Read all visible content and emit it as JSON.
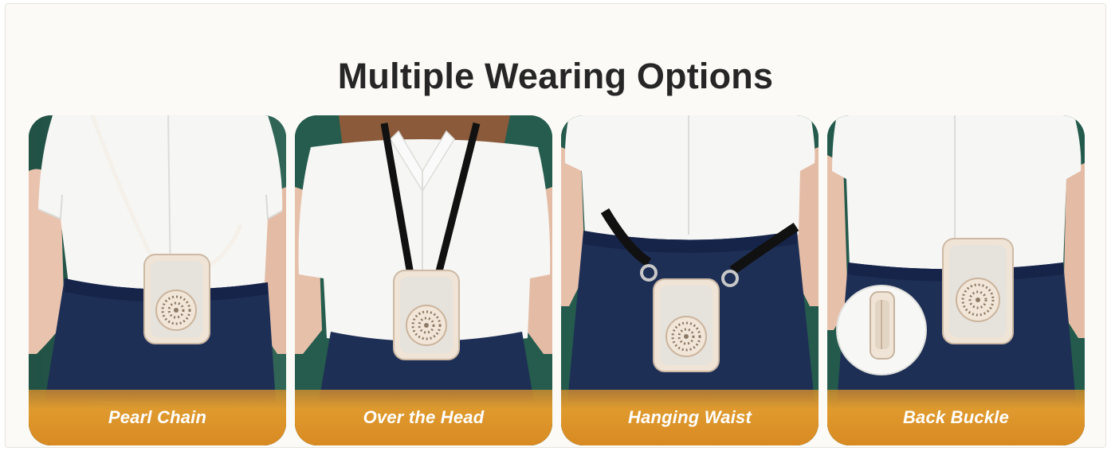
{
  "heading": {
    "title": "Multiple Wearing Options"
  },
  "options": [
    {
      "label": "Pearl Chain",
      "icon": "pearl-chain-photo"
    },
    {
      "label": "Over the Head",
      "icon": "lanyard-photo"
    },
    {
      "label": "Hanging Waist",
      "icon": "waist-strap-photo"
    },
    {
      "label": "Back Buckle",
      "icon": "back-clip-photo"
    }
  ],
  "colors": {
    "caption_orange": "#df9a2e",
    "background_green": "#235a4c",
    "skirt_navy": "#1d2d52",
    "shirt_white": "#f4f4f2",
    "device_cream": "#efe4d6"
  }
}
